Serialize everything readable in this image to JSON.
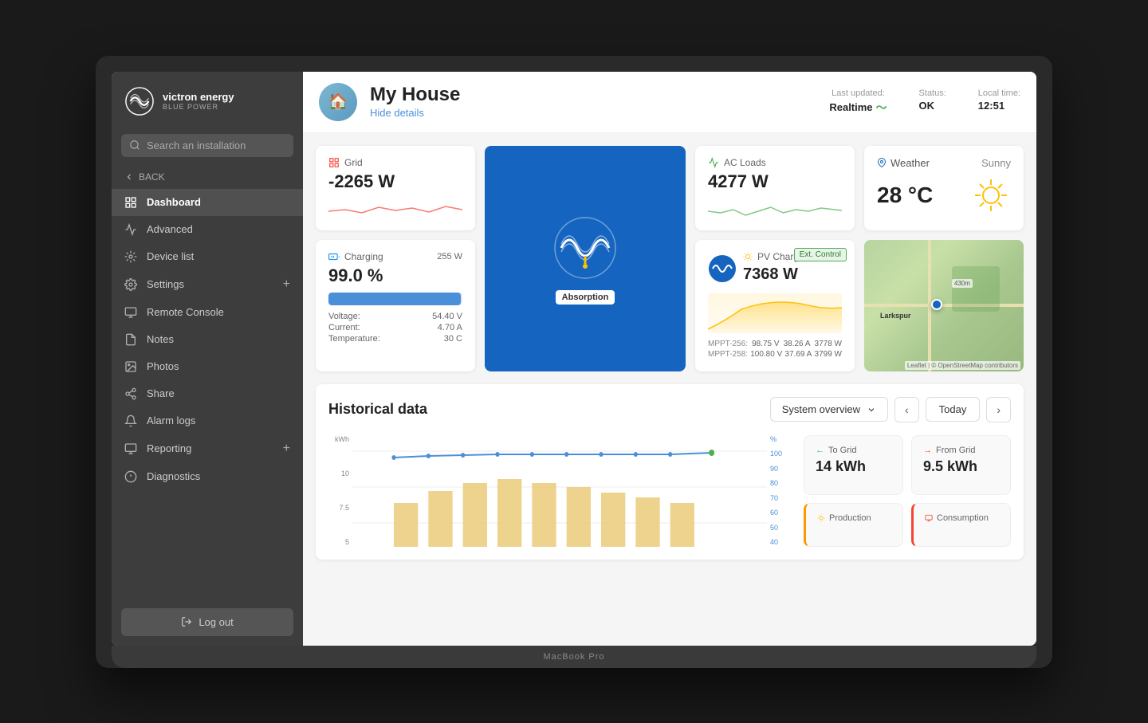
{
  "laptop": {
    "model": "MacBook Pro"
  },
  "sidebar": {
    "logo_text": "victron energy",
    "logo_sub": "Blue Power",
    "search_placeholder": "Search an installation",
    "back_label": "BACK",
    "nav_items": [
      {
        "id": "dashboard",
        "label": "Dashboard",
        "active": true
      },
      {
        "id": "advanced",
        "label": "Advanced",
        "active": false
      },
      {
        "id": "device-list",
        "label": "Device list",
        "active": false
      },
      {
        "id": "settings",
        "label": "Settings",
        "active": false,
        "has_plus": true
      },
      {
        "id": "remote-console",
        "label": "Remote Console",
        "active": false
      },
      {
        "id": "notes",
        "label": "Notes",
        "active": false
      },
      {
        "id": "photos",
        "label": "Photos",
        "active": false
      },
      {
        "id": "share",
        "label": "Share",
        "active": false
      },
      {
        "id": "alarm-logs",
        "label": "Alarm logs",
        "active": false
      },
      {
        "id": "reporting",
        "label": "Reporting",
        "active": false,
        "has_plus": true
      },
      {
        "id": "diagnostics",
        "label": "Diagnostics",
        "active": false
      }
    ],
    "logout_label": "Log out"
  },
  "header": {
    "house_name": "My House",
    "hide_details_label": "Hide details",
    "last_updated_label": "Last updated:",
    "realtime_label": "Realtime",
    "status_label": "Status:",
    "status_value": "OK",
    "local_time_label": "Local time:",
    "local_time_value": "12:51"
  },
  "grid_card": {
    "title": "Grid",
    "value": "-2265 W"
  },
  "inverter": {
    "label": "Absorption"
  },
  "ac_loads_card": {
    "title": "AC Loads",
    "value": "4277 W"
  },
  "battery_card": {
    "title": "Charging",
    "watts": "255 W",
    "percent": "99.0 %",
    "voltage_label": "Voltage:",
    "voltage_value": "54.40 V",
    "current_label": "Current:",
    "current_value": "4.70 A",
    "temp_label": "Temperature:",
    "temp_value": "30 C",
    "fill_percent": 99
  },
  "pv_card": {
    "title": "PV Charger",
    "value": "7368 W",
    "ext_control": "Ext. Control",
    "mppt256_label": "MPPT-256:",
    "mppt256_v": "98.75 V",
    "mppt256_a": "38.26 A",
    "mppt256_w": "3778 W",
    "mppt258_label": "MPPT-258:",
    "mppt258_v": "100.80 V",
    "mppt258_a": "37.69 A",
    "mppt258_w": "3799 W"
  },
  "weather_card": {
    "title": "Weather",
    "condition": "Sunny",
    "temperature": "28 °C"
  },
  "map_card": {
    "town": "Larkspur",
    "attribution": "Leaflet | © OpenStreetMap contributors"
  },
  "historical": {
    "title": "Historical data",
    "dropdown_label": "System overview",
    "today_label": "Today",
    "y_axis_label": "kWh",
    "y_right_label": "%",
    "y_values": [
      10,
      7.5,
      5
    ],
    "y_right_values": [
      100,
      90,
      80,
      70,
      60,
      50,
      40
    ]
  },
  "stats": {
    "to_grid_label": "To Grid",
    "to_grid_value": "14 kWh",
    "from_grid_label": "From Grid",
    "from_grid_value": "9.5 kWh",
    "production_label": "Production",
    "consumption_label": "Consumption"
  }
}
